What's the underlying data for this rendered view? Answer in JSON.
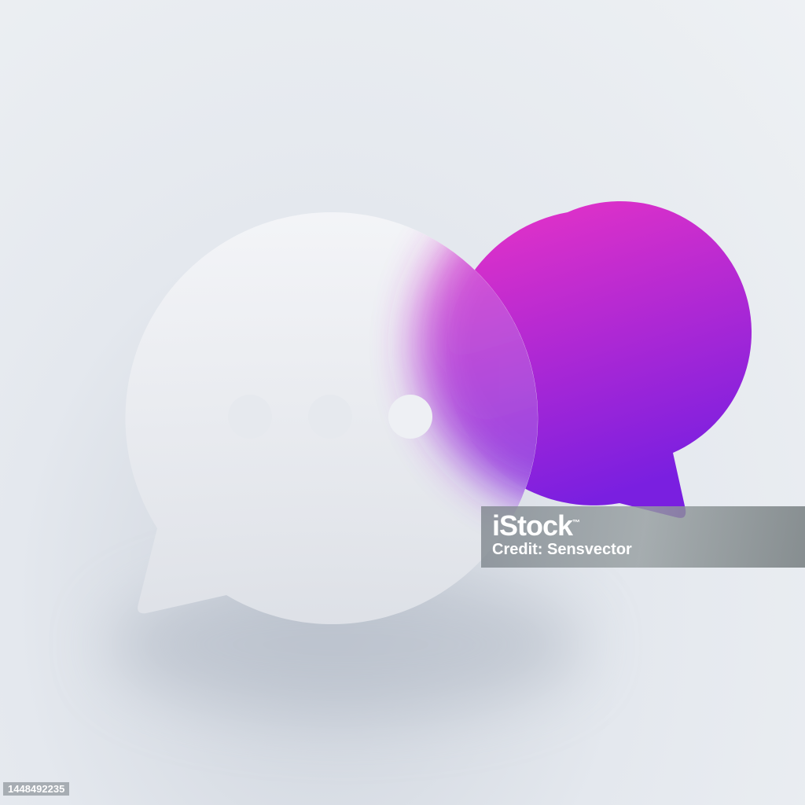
{
  "illustration": {
    "subject": "chat-bubbles",
    "colors": {
      "accent_top": "#e832c8",
      "accent_bottom": "#7a1fe0",
      "glass": "#f2f4f7",
      "background": "#e8ecf0"
    }
  },
  "watermark": {
    "brand": "iStock",
    "trademark": "™",
    "credit": "Credit: Sensvector"
  },
  "image_id": "1448492235"
}
